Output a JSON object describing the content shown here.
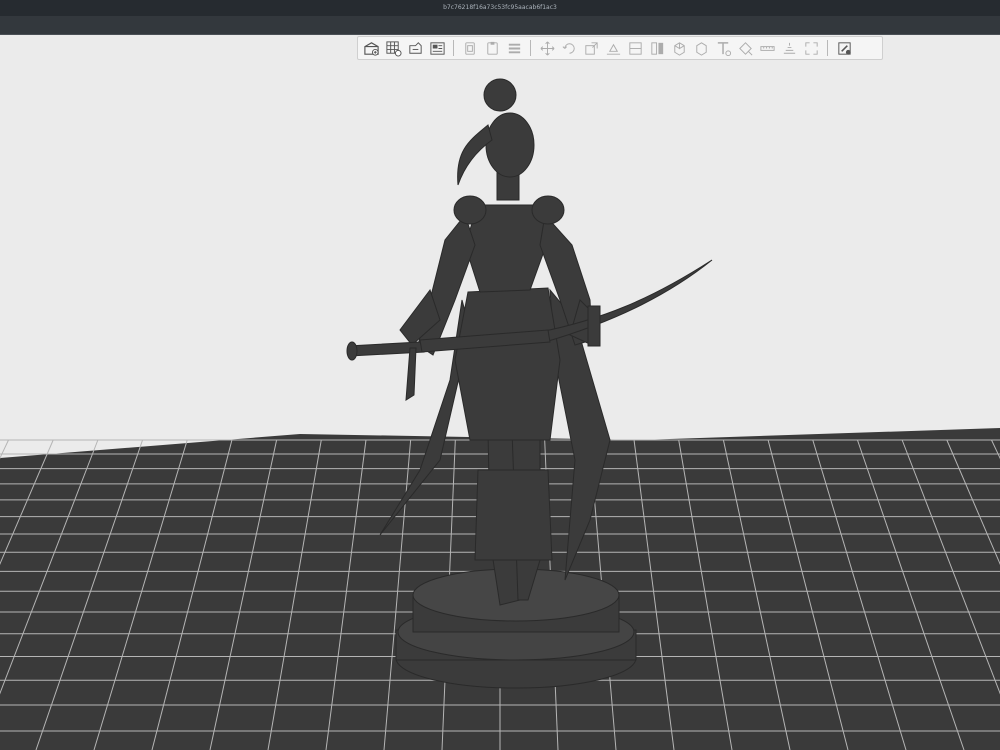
{
  "window": {
    "title": "b7c76218f16a73c53fc95aacab6f1ac3"
  },
  "toolbar": {
    "groups": [
      [
        "add-object-icon",
        "grid-view-icon",
        "select-tool-icon",
        "settings-panel-icon"
      ],
      [
        "copy-icon",
        "paste-icon",
        "layers-icon"
      ],
      [
        "move-icon",
        "rotate-icon",
        "scale-icon",
        "lay-flat-icon",
        "cut-icon",
        "split-icon",
        "hollow-icon",
        "support-icon",
        "text-tool-icon",
        "paint-tool-icon",
        "measure-icon",
        "arrange-icon",
        "fit-view-icon"
      ],
      [
        "edit-object-icon"
      ]
    ]
  },
  "scene": {
    "background_color": "#ebebeb",
    "plate_color": "#3a3a3a",
    "grid_line_color": "#b5b5b5",
    "model_color": "#3b3b3b"
  }
}
